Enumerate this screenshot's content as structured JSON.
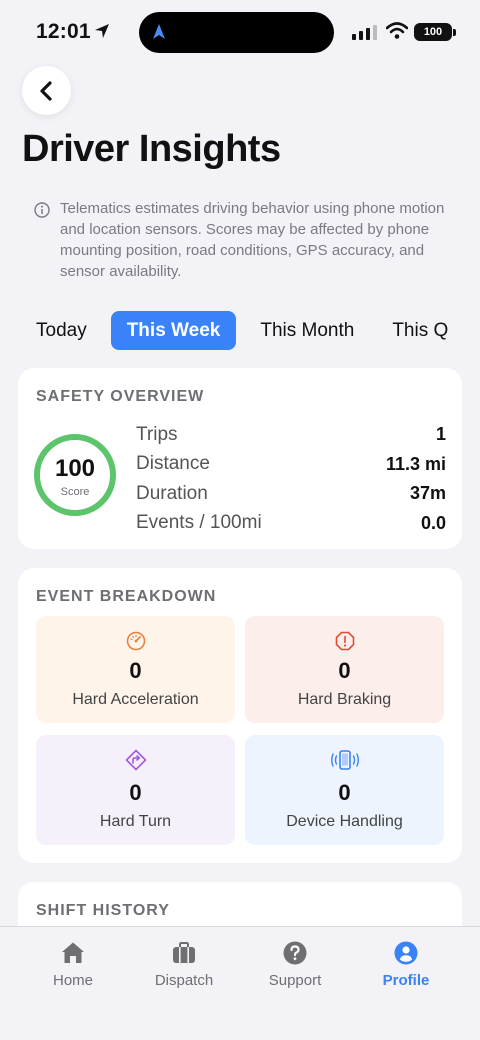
{
  "status_bar": {
    "time": "12:01",
    "battery": "100"
  },
  "header": {
    "title": "Driver Insights"
  },
  "info_text": "Telematics estimates driving behavior using phone motion and location sensors. Scores may be affected by phone mounting position, road conditions, GPS accuracy, and sensor availability.",
  "tabs": [
    {
      "label": "Today"
    },
    {
      "label": "This Week",
      "active": true
    },
    {
      "label": "This Month"
    },
    {
      "label": "This Q"
    }
  ],
  "safety": {
    "title": "SAFETY OVERVIEW",
    "score": "100",
    "score_label": "Score",
    "score_color": "#5cc46a",
    "stats": [
      {
        "label": "Trips",
        "value": "1"
      },
      {
        "label": "Distance",
        "value": "11.3 mi"
      },
      {
        "label": "Duration",
        "value": "37m"
      },
      {
        "label": "Events / 100mi",
        "value": "0.0"
      }
    ]
  },
  "events": {
    "title": "EVENT BREAKDOWN",
    "items": [
      {
        "label": "Hard Acceleration",
        "value": "0",
        "icon": "speedometer-icon",
        "bg": "#fff4ea",
        "color": "#e8813b"
      },
      {
        "label": "Hard Braking",
        "value": "0",
        "icon": "alert-octagon-icon",
        "bg": "#fcefeb",
        "color": "#e04b35"
      },
      {
        "label": "Hard Turn",
        "value": "0",
        "icon": "turn-right-icon",
        "bg": "#f6f0fb",
        "color": "#a259d9"
      },
      {
        "label": "Device Handling",
        "value": "0",
        "icon": "phone-vibrate-icon",
        "bg": "#eef4fd",
        "color": "#3a82f7"
      }
    ]
  },
  "shift_history": {
    "title": "SHIFT HISTORY"
  },
  "tabbar": {
    "items": [
      {
        "label": "Home",
        "icon": "home-icon"
      },
      {
        "label": "Dispatch",
        "icon": "briefcase-icon"
      },
      {
        "label": "Support",
        "icon": "help-circle-icon"
      },
      {
        "label": "Profile",
        "icon": "profile-icon",
        "active": true
      }
    ],
    "active_color": "#3a82f7"
  },
  "colors": {
    "accent": "#3a82f7",
    "background": "#f2f2f7"
  }
}
